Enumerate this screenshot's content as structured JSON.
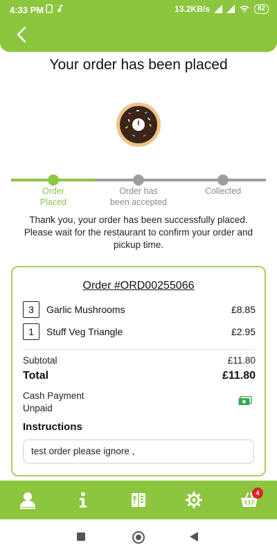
{
  "status_bar": {
    "time": "4:33 PM",
    "speed": "13.2KB/s",
    "battery": "82"
  },
  "page": {
    "title": "Your order has been placed"
  },
  "progress": {
    "steps": [
      {
        "label_line1": "Order",
        "label_line2": "Placed",
        "active": true
      },
      {
        "label_line1": "Order has",
        "label_line2": "been accepted",
        "active": false
      },
      {
        "label_line1": "Collected",
        "label_line2": "",
        "active": false
      }
    ]
  },
  "message": {
    "line1": "Thank you, your order has been successfully placed.",
    "line2": "Please wait for the restaurant to confirm your order and",
    "line3": "pickup time."
  },
  "order": {
    "title": "Order #ORD00255066",
    "items": [
      {
        "qty": "3",
        "name": "Garlic Mushrooms",
        "price": "£8.85"
      },
      {
        "qty": "1",
        "name": "Stuff Veg Triangle",
        "price": "£2.95"
      }
    ],
    "subtotal_label": "Subtotal",
    "subtotal_value": "£11.80",
    "total_label": "Total",
    "total_value": "£11.80",
    "payment_method": "Cash Payment",
    "payment_status": "Unpaid",
    "instructions_label": "Instructions",
    "instructions_text": "test order please ignore ,"
  },
  "bottom_nav": {
    "items": [
      "user-icon",
      "info-icon",
      "menu-icon",
      "settings-icon",
      "basket-icon"
    ],
    "basket_badge": "4"
  },
  "colors": {
    "brand": "#8cc63f",
    "badge": "#e0202a",
    "inactive": "#9e9e9e"
  }
}
